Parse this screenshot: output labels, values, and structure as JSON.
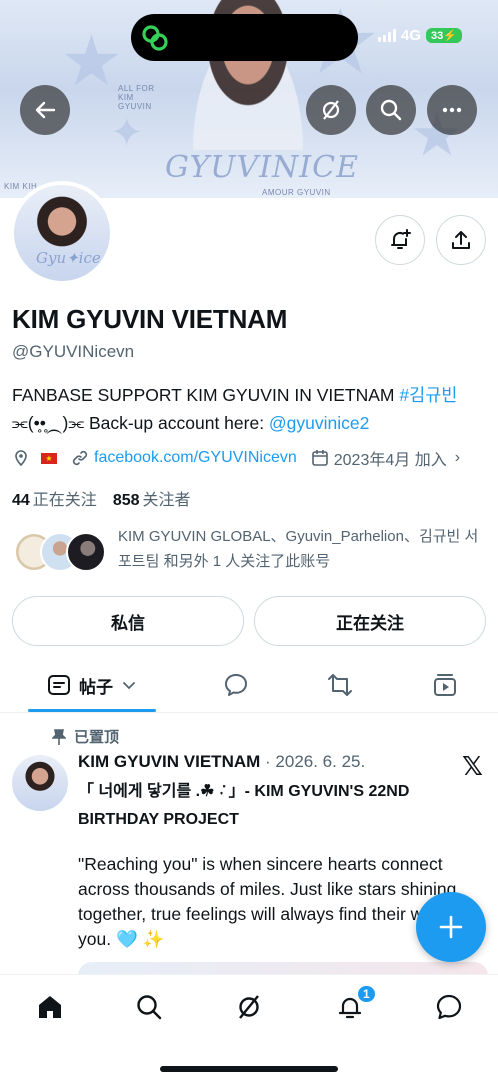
{
  "status_bar": {
    "network": "4G",
    "battery": "33"
  },
  "banner": {
    "small_left": "KIM KIH",
    "small_top": "ALL FOR KIM GYUVIN",
    "script": "GYUVINICE",
    "small_bottom": "AMOUR GYUVIN"
  },
  "profile": {
    "name": "KIM GYUVIN VIETNAM",
    "handle": "@GYUVINicevn",
    "bio_line1": "FANBASE SUPPORT KIM GYUVIN IN VIETNAM ",
    "bio_hashtag": "#김규빈",
    "bio_line2": "⫘(•̥•̥⁔)⫘ Back-up account here: ",
    "bio_mention": "@gyuvinice2",
    "link": "facebook.com/GYUVINicevn",
    "joined": "2023年4月 加入",
    "following_count": "44",
    "following_label": "正在关注",
    "followers_count": "858",
    "followers_label": "关注者",
    "followed_by": "KIM GYUVIN GLOBAL、Gyuvin_Parhelion、김규빈 서포트팀 和另外 1 人关注了此账号",
    "message_button": "私信",
    "following_button": "正在关注"
  },
  "tabs": {
    "posts": "帖子"
  },
  "post": {
    "pinned_label": "已置顶",
    "author": "KIM GYUVIN VIETNAM",
    "date": " · 2026. 6. 25.",
    "title": "「 너에게 닿기를 .☘︎ ݁˖ 」- KIM GYUVIN'S 22ND BIRTHDAY PROJECT",
    "body": "\"Reaching you\" is when sincere hearts connect across thousands of miles. Just like stars shining together, true feelings will always find their way to you. 🩵 ✨"
  },
  "nav": {
    "notification_badge": "1"
  },
  "colors": {
    "accent": "#1d9bf0",
    "text": "#0f1419",
    "muted": "#536471"
  }
}
